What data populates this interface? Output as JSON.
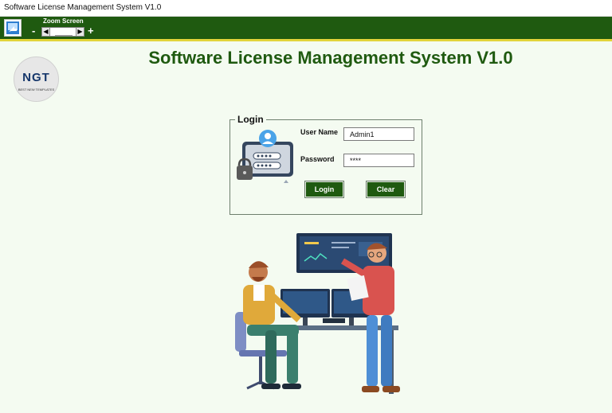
{
  "window": {
    "title": "Software License Management System V1.0"
  },
  "toolbar": {
    "zoom_label": "Zoom Screen",
    "zoom_minus": "-",
    "zoom_plus": "+",
    "slider_left": "◀",
    "slider_right": "▶"
  },
  "logo": {
    "letters": "NGT",
    "subtitle": "BEST NEW TEMPLATES"
  },
  "page": {
    "title": "Software License Management System V1.0"
  },
  "login": {
    "legend": "Login",
    "username_label": "User Name",
    "username_value": "Admin1",
    "password_label": "Password",
    "password_value": "****",
    "login_button": "Login",
    "clear_button": "Clear"
  },
  "colors": {
    "toolbar_green": "#1f5a10",
    "accent_yellow": "#e2d43a",
    "title_green": "#1f5a10",
    "background": "#f4fbf1"
  },
  "icons": {
    "app_icon": "app-icon",
    "login_illustration": "user-lock-icon",
    "hero": "team-computer-illustration"
  }
}
